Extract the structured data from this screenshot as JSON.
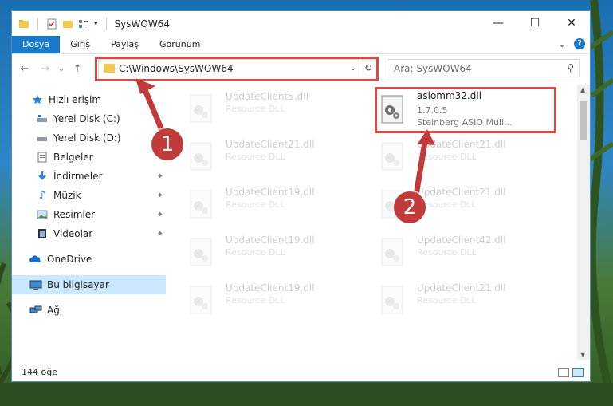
{
  "window": {
    "title": "SysWOW64",
    "controls": {
      "minimize": "—",
      "maximize": "☐",
      "close": "✕"
    }
  },
  "ribbon": {
    "tabs": [
      "Dosya",
      "Giriş",
      "Paylaş",
      "Görünüm"
    ],
    "active_tab": "Dosya",
    "help": "?",
    "expand": "⌄"
  },
  "nav": {
    "back": "←",
    "forward": "→",
    "recent": "⌄",
    "up": "↑"
  },
  "address": {
    "path": "C:\\Windows\\SysWOW64",
    "dropdown": "⌄",
    "refresh": "↻"
  },
  "search": {
    "placeholder": "Ara: SysWOW64",
    "icon": "⚲"
  },
  "sidebar": {
    "items": [
      {
        "label": "Hızlı erişim",
        "icon": "star-icon",
        "pinned": false
      },
      {
        "label": "Yerel Disk (C:)",
        "icon": "drive-icon",
        "pinned": false
      },
      {
        "label": "Yerel Disk (D:)",
        "icon": "drive-icon",
        "pinned": false
      },
      {
        "label": "Belgeler",
        "icon": "documents-icon",
        "pinned": true
      },
      {
        "label": "İndirmeler",
        "icon": "download-icon",
        "pinned": true
      },
      {
        "label": "Müzik",
        "icon": "music-icon",
        "pinned": true
      },
      {
        "label": "Resimler",
        "icon": "pictures-icon",
        "pinned": true
      },
      {
        "label": "Videolar",
        "icon": "video-icon",
        "pinned": true
      },
      {
        "label": "OneDrive",
        "icon": "cloud-icon",
        "pinned": false
      },
      {
        "label": "Bu bilgisayar",
        "icon": "computer-icon",
        "pinned": false
      },
      {
        "label": "Ağ",
        "icon": "network-icon",
        "pinned": false
      }
    ],
    "pin_glyph": "📌"
  },
  "files": {
    "highlighted": {
      "name": "asiomm32.dll",
      "version": "1.7.0.5",
      "desc": "Steinberg ASIO Muli..."
    },
    "left_column": [
      {
        "name": "UpdateClient5.dll",
        "desc": "Resource DLL"
      },
      {
        "name": "UpdateClient21.dll",
        "desc": "Resource DLL"
      },
      {
        "name": "UpdateClient19.dll",
        "desc": "Resource DLL"
      },
      {
        "name": "UpdateClient19.dll",
        "desc": "Resource DLL"
      },
      {
        "name": "UpdateClient19.dll",
        "desc": "Resource DLL"
      }
    ],
    "right_column": [
      {
        "name": "UpdateClient21.dll",
        "desc": "Resource DLL"
      },
      {
        "name": "UpdateClient21.dll",
        "desc": "Resource DLL"
      },
      {
        "name": "UpdateClient42.dll",
        "desc": "Resource DLL"
      },
      {
        "name": "UpdateClient21.dll",
        "desc": "Resource DLL"
      }
    ]
  },
  "status": {
    "count": "144 öğe"
  },
  "callouts": {
    "one": "1",
    "two": "2"
  },
  "colors": {
    "accent": "#1979ca",
    "highlight": "#d84a4a",
    "badge": "#c23b3b"
  }
}
